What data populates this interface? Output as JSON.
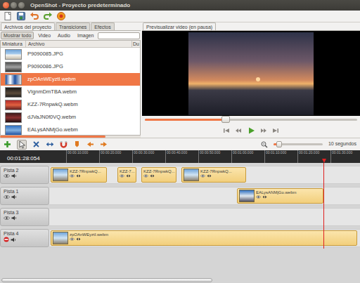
{
  "window": {
    "title": "OpenShot - Proyecto predeterminado"
  },
  "project_tabs": [
    {
      "label": "Archivos del proyecto",
      "selected": true
    },
    {
      "label": "Transiciones",
      "selected": false
    },
    {
      "label": "Efectos",
      "selected": false
    }
  ],
  "filters": [
    {
      "label": "Mostrar todo",
      "selected": true
    },
    {
      "label": "Video",
      "selected": false
    },
    {
      "label": "Audio",
      "selected": false
    },
    {
      "label": "Imagen",
      "selected": false
    }
  ],
  "files": {
    "columns": [
      "Miniatura",
      "Archivo",
      "Du"
    ],
    "rows": [
      {
        "name": "P9090085.JPG",
        "selected": false
      },
      {
        "name": "P9090086.JPG",
        "selected": false
      },
      {
        "name": "zpOAnWEyztI.webm",
        "selected": true
      },
      {
        "name": "VIgnmDmTBA.webm",
        "selected": false
      },
      {
        "name": "KZZ-7RnpwkQ.webm",
        "selected": false
      },
      {
        "name": "dJVaJN0f0VQ.webm",
        "selected": false
      },
      {
        "name": "EALysANMjGo.webm",
        "selected": false
      }
    ]
  },
  "preview": {
    "tab": "Previsualizar video (en pausa)",
    "level": 0.38
  },
  "timeline": {
    "current_time": "00:01:28:054",
    "zoom_level": 0.12,
    "zoom_label": "10 segundos",
    "ticks": [
      "00:00:10.000",
      "00:00:20.000",
      "00:00:30.000",
      "00:00:40.000",
      "00:00:50.000",
      "00:01:00.000",
      "00:01:10.000",
      "00:01:20.000",
      "00:01:30.000"
    ],
    "tracks": [
      {
        "name": "Pista 2",
        "visible": true,
        "clips": [
          {
            "name": "KZZ-7RnpwkQ..."
          },
          {
            "name": "KZZ-7..."
          },
          {
            "name": "KZZ-7RnpwkQ..."
          },
          {
            "name": "KZZ-7RnpwkQ..."
          }
        ]
      },
      {
        "name": "Pista 1",
        "visible": true,
        "clips": [
          {
            "name": "EALysANMjGo.webm"
          }
        ]
      },
      {
        "name": "Pista 3",
        "visible": true,
        "clips": []
      },
      {
        "name": "Pista 4",
        "visible": false,
        "clips": [
          {
            "name": "zpOAnWEyztI.webm"
          }
        ]
      }
    ]
  }
}
